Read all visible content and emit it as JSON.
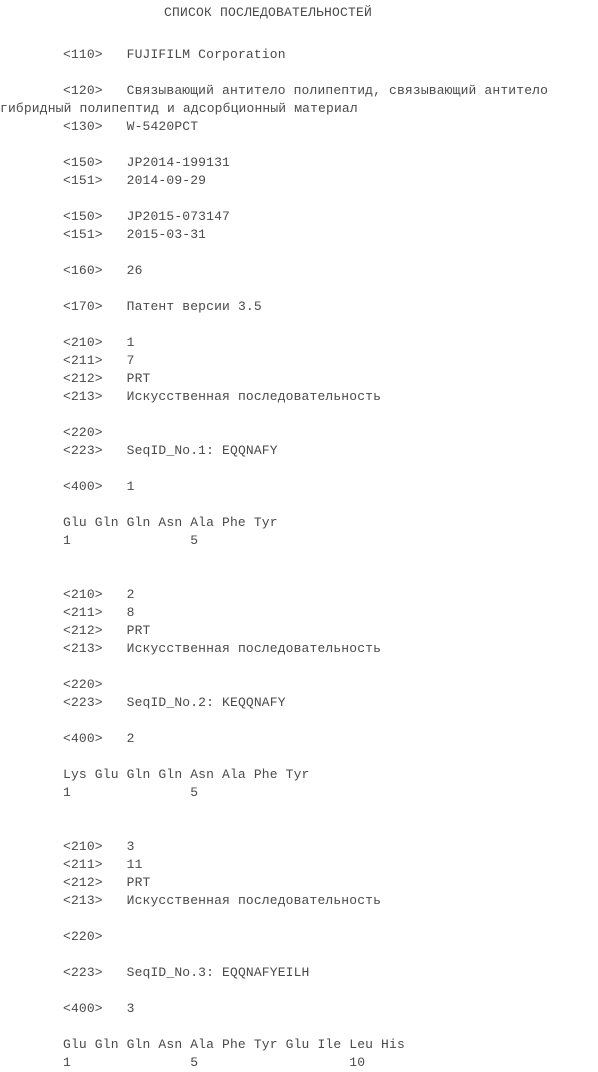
{
  "document": {
    "title": "СПИСОК ПОСЛЕДОВАТЕЛЬНОСТЕЙ",
    "header_fields": {
      "applicant_tag": "<110>",
      "applicant_value": "FUJIFILM Corporation",
      "invention_title_tag": "<120>",
      "invention_title_value": "Связывающий антитело полипептид, связывающий антитело",
      "invention_title_continuation": "гибридный полипептид и адсорбционный материал",
      "file_reference_tag": "<130>",
      "file_reference_value": "W-5420PCT",
      "priority_1_number_tag": "<150>",
      "priority_1_number_value": "JP2014-199131",
      "priority_1_date_tag": "<151>",
      "priority_1_date_value": "2014-09-29",
      "priority_2_number_tag": "<150>",
      "priority_2_number_value": "JP2015-073147",
      "priority_2_date_tag": "<151>",
      "priority_2_date_value": "2015-03-31",
      "number_of_seqs_tag": "<160>",
      "number_of_seqs_value": "26",
      "software_tag": "<170>",
      "software_value": "Патент версии 3.5"
    },
    "sequences": [
      {
        "seq_id_tag": "<210>",
        "seq_id_value": "1",
        "length_tag": "<211>",
        "length_value": "7",
        "type_tag": "<212>",
        "type_value": "PRT",
        "organism_tag": "<213>",
        "organism_value": "Искусственная последовательность",
        "feature_tag": "<220>",
        "feature_value": "",
        "other_info_tag": "<223>",
        "other_info_value": "SeqID_No.1: EQQNAFY",
        "sequence_tag": "<400>",
        "sequence_value": "1",
        "residues_line": "Glu Gln Gln Asn Ala Phe Tyr",
        "numbering_line": "1               5",
        "gap_before_other_info": false
      },
      {
        "seq_id_tag": "<210>",
        "seq_id_value": "2",
        "length_tag": "<211>",
        "length_value": "8",
        "type_tag": "<212>",
        "type_value": "PRT",
        "organism_tag": "<213>",
        "organism_value": "Искусственная последовательность",
        "feature_tag": "<220>",
        "feature_value": "",
        "other_info_tag": "<223>",
        "other_info_value": "SeqID_No.2: KEQQNAFY",
        "sequence_tag": "<400>",
        "sequence_value": "2",
        "residues_line": "Lys Glu Gln Gln Asn Ala Phe Tyr",
        "numbering_line": "1               5",
        "gap_before_other_info": false
      },
      {
        "seq_id_tag": "<210>",
        "seq_id_value": "3",
        "length_tag": "<211>",
        "length_value": "11",
        "type_tag": "<212>",
        "type_value": "PRT",
        "organism_tag": "<213>",
        "organism_value": "Искусственная последовательность",
        "feature_tag": "<220>",
        "feature_value": "",
        "other_info_tag": "<223>",
        "other_info_value": "SeqID_No.3: EQQNAFYEILH",
        "sequence_tag": "<400>",
        "sequence_value": "3",
        "residues_line": "Glu Gln Gln Asn Ala Phe Tyr Glu Ile Leu His",
        "numbering_line": "1               5                   10",
        "gap_before_other_info": true
      }
    ]
  }
}
